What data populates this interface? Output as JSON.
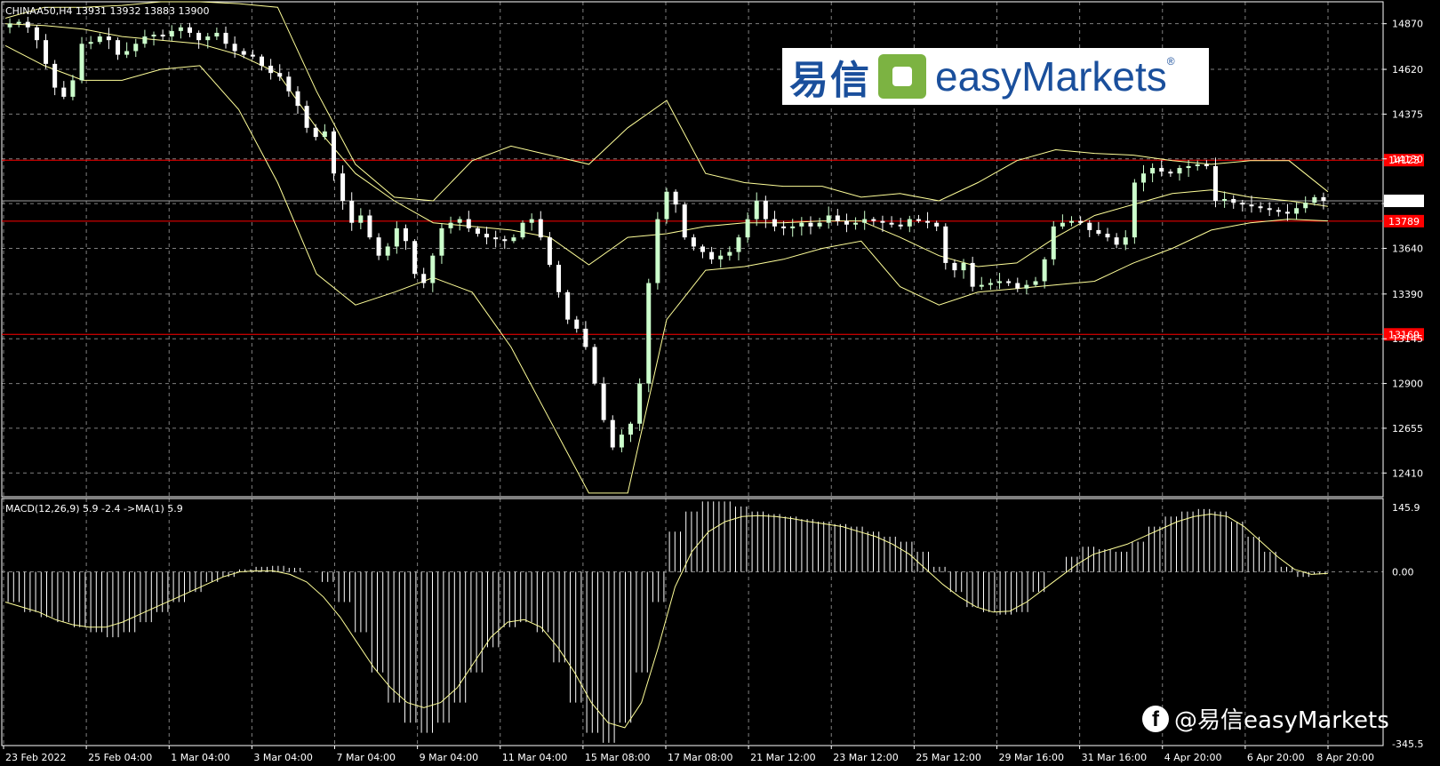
{
  "header": {
    "symbol_line": "CHINAA50,H4  13931 13932 13883 13900",
    "macd_line": "MACD(12,26,9) 5.9 -2.4  ->MA(1) 5.9"
  },
  "logo": {
    "cn": "易信",
    "en": "easyMarkets",
    "reg": "®"
  },
  "watermark": {
    "text": "@易信easyMarkets",
    "icon": "facebook-icon"
  },
  "colors": {
    "background": "#000000",
    "grid": "#7f7f7f",
    "bull_candle": "#ccffcc",
    "bear_candle": "#ffffff",
    "bands": "#ffff99",
    "level_lines": "#ff0000",
    "price_line": "#a0a0a0"
  },
  "chart_data": [
    {
      "type": "candlestick",
      "title": "CHINAA50,H4",
      "ylim": [
        12280,
        14990
      ],
      "y_ticks": [
        "14870",
        "14620",
        "14375",
        "14130",
        "13885",
        "13640",
        "13390",
        "13145",
        "12900",
        "12655",
        "12410"
      ],
      "x_ticks": [
        "23 Feb 2022",
        "25 Feb 04:00",
        "1 Mar 04:00",
        "3 Mar 04:00",
        "7 Mar 04:00",
        "9 Mar 04:00",
        "11 Mar 04:00",
        "15 Mar 08:00",
        "17 Mar 08:00",
        "21 Mar 12:00",
        "23 Mar 12:00",
        "25 Mar 12:00",
        "29 Mar 16:00",
        "31 Mar 16:00",
        "4 Apr 20:00",
        "6 Apr 20:00",
        "8 Apr 20:00"
      ],
      "last_ohlc": {
        "open": 13931,
        "high": 13932,
        "low": 13883,
        "close": 13900
      },
      "current_price": {
        "value": 13900,
        "label": "13900"
      },
      "levels": [
        {
          "value": 14123,
          "label": "14123"
        },
        {
          "value": 13789,
          "label": "13789"
        },
        {
          "value": 13169,
          "label": "13169"
        }
      ],
      "close_series": [
        14870,
        14880,
        14850,
        14780,
        14650,
        14520,
        14470,
        14560,
        14760,
        14770,
        14800,
        14780,
        14700,
        14720,
        14760,
        14800,
        14810,
        14800,
        14830,
        14850,
        14820,
        14780,
        14800,
        14820,
        14760,
        14720,
        14700,
        14690,
        14640,
        14600,
        14580,
        14500,
        14420,
        14300,
        14250,
        14280,
        14050,
        13900,
        13780,
        13820,
        13700,
        13600,
        13650,
        13750,
        13680,
        13500,
        13450,
        13600,
        13750,
        13780,
        13800,
        13750,
        13720,
        13700,
        13690,
        13680,
        13700,
        13780,
        13800,
        13700,
        13550,
        13400,
        13250,
        13200,
        13100,
        12900,
        12700,
        12550,
        12620,
        12680,
        12900,
        13450,
        13800,
        13950,
        13880,
        13700,
        13650,
        13620,
        13580,
        13600,
        13620,
        13700,
        13800,
        13900,
        13800,
        13760,
        13750,
        13760,
        13780,
        13760,
        13780,
        13820,
        13790,
        13770,
        13780,
        13800,
        13790,
        13780,
        13770,
        13760,
        13800,
        13790,
        13780,
        13760,
        13560,
        13520,
        13560,
        13430,
        13440,
        13450,
        13460,
        13450,
        13420,
        13440,
        13460,
        13580,
        13760,
        13780,
        13790,
        13780,
        13740,
        13720,
        13700,
        13660,
        13700,
        14000,
        14050,
        14080,
        14060,
        14050,
        14080,
        14090,
        14100,
        14090,
        13900,
        13910,
        13890,
        13880,
        13870,
        13860,
        13850,
        13840,
        13830,
        13860,
        13890,
        13920,
        13900
      ],
      "bollinger": {
        "upper": [
          14900,
          14960,
          14960,
          14970,
          14990,
          14990,
          14980,
          14960,
          14500,
          14100,
          13920,
          13900,
          14120,
          14200,
          14150,
          14100,
          14300,
          14450,
          14050,
          14000,
          13980,
          13980,
          13920,
          13940,
          13900,
          14000,
          14120,
          14180,
          14160,
          14150,
          14120,
          14100,
          14120,
          14120,
          13950
        ],
        "middle": [
          14870,
          14860,
          14840,
          14800,
          14780,
          14760,
          14700,
          14600,
          14300,
          14050,
          13900,
          13780,
          13760,
          13740,
          13700,
          13550,
          13700,
          13720,
          13760,
          13780,
          13780,
          13790,
          13790,
          13700,
          13600,
          13540,
          13560,
          13700,
          13820,
          13880,
          13940,
          13960,
          13920,
          13900,
          13870
        ],
        "lower": [
          14750,
          14640,
          14560,
          14560,
          14620,
          14640,
          14400,
          14000,
          13500,
          13330,
          13400,
          13480,
          13400,
          13100,
          12700,
          12300,
          12300,
          13250,
          13520,
          13540,
          13580,
          13640,
          13680,
          13430,
          13330,
          13400,
          13420,
          13440,
          13460,
          13560,
          13640,
          13740,
          13780,
          13800,
          13790
        ]
      }
    },
    {
      "type": "bar",
      "title": "MACD(12,26,9)",
      "ylim": [
        -345.5,
        145.9
      ],
      "y_ticks": [
        "145.9",
        "0.00",
        "-345.5"
      ],
      "values_summary": {
        "macd": 5.9,
        "signal": -2.4,
        "ma": 5.9
      },
      "histogram": [
        -60,
        -80,
        -90,
        -100,
        -110,
        -120,
        -130,
        -120,
        -100,
        -80,
        -60,
        -40,
        -20,
        -10,
        5,
        10,
        12,
        8,
        0,
        -20,
        -60,
        -120,
        -200,
        -260,
        -300,
        -320,
        -300,
        -260,
        -200,
        -150,
        -110,
        -100,
        -120,
        -180,
        -260,
        -320,
        -340,
        -300,
        -200,
        -60,
        80,
        120,
        140,
        140,
        130,
        120,
        115,
        110,
        105,
        100,
        95,
        90,
        80,
        70,
        60,
        40,
        10,
        -40,
        -70,
        -80,
        -85,
        -80,
        -40,
        0,
        30,
        50,
        45,
        40,
        60,
        90,
        110,
        120,
        125,
        120,
        100,
        70,
        40,
        10,
        -10,
        -5
      ],
      "signal_line": [
        -60,
        -70,
        -80,
        -95,
        -105,
        -110,
        -110,
        -100,
        -85,
        -70,
        -55,
        -40,
        -25,
        -10,
        0,
        2,
        2,
        -5,
        -20,
        -50,
        -90,
        -140,
        -190,
        -230,
        -260,
        -270,
        -260,
        -230,
        -180,
        -130,
        -100,
        -95,
        -110,
        -150,
        -200,
        -260,
        -300,
        -310,
        -260,
        -150,
        -30,
        40,
        80,
        100,
        110,
        112,
        110,
        106,
        100,
        95,
        90,
        80,
        70,
        55,
        35,
        5,
        -25,
        -50,
        -70,
        -80,
        -78,
        -60,
        -35,
        -10,
        15,
        35,
        45,
        55,
        70,
        85,
        100,
        110,
        115,
        110,
        90,
        60,
        30,
        5,
        -5,
        -3
      ]
    }
  ]
}
